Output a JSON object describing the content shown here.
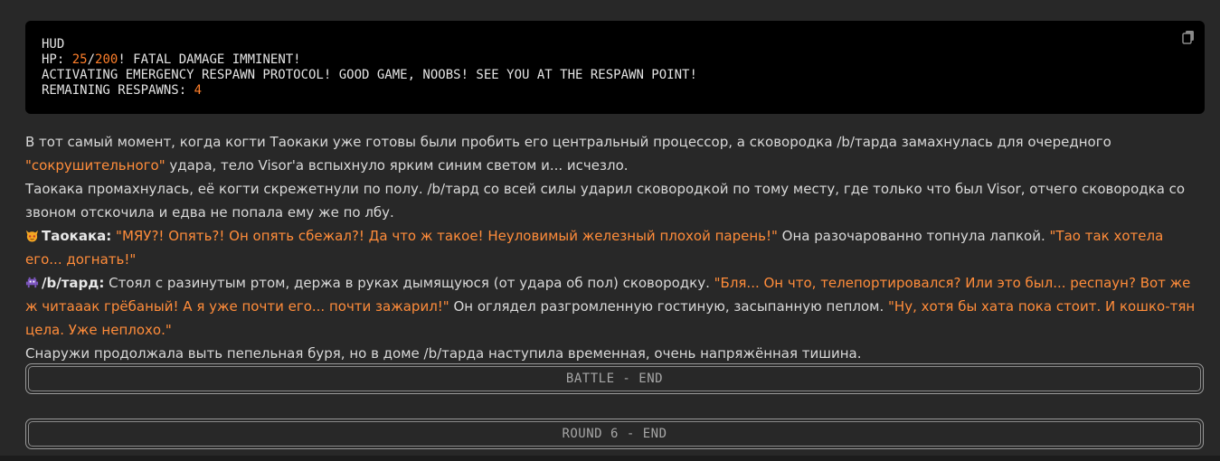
{
  "code": {
    "title": "HUD",
    "hp_label": "HP: ",
    "hp_current": "25",
    "hp_sep": "/",
    "hp_max": "200",
    "hp_suffix": "! FATAL DAMAGE IMMINENT!",
    "line_activate": "ACTIVATING EMERGENCY RESPAWN PROTOCOL! GOOD GAME, NOOBS! SEE YOU AT THE RESPAWN POINT!",
    "respawns_label": "REMAINING RESPAWNS: ",
    "respawns_value": "4",
    "copy_icon": "copy-icon"
  },
  "story": {
    "p1_a": "В тот самый момент, когда когти Таокаки уже готовы были пробить его центральный процессор, а сковородка /b/тарда замахнулась для очередного ",
    "p1_q": "\"сокрушительного\"",
    "p1_b": " удара, тело Visor'а вспыхнуло ярким синим светом и... исчезло.",
    "p2": "Таокака промахнулась, её когти скрежетнули по полу. /b/тард со всей силы ударил сковородкой по тому месту, где только что был Visor, отчего сковородка со звоном отскочила и едва не попала ему же по лбу.",
    "p3_emoji": "cat-face-icon",
    "p3_speaker": "Таокака:",
    "p3_q1": "\"МЯУ?! Опять?! Он опять сбежал?! Да что ж такое! Неуловимый железный плохой парень!\"",
    "p3_mid": " Она разочарованно топнула лапкой. ",
    "p3_q2": "\"Тао так хотела его... догнать!\"",
    "p4_emoji": "alien-monster-icon",
    "p4_speaker": "/b/тард:",
    "p4_a": " Стоял с разинутым ртом, держа в руках дымящуюся (от удара об пол) сковородку. ",
    "p4_q1": "\"Бля... Он что, телепортировался? Или это был... респаун? Вот же ж читааак грёбаный! А я уже почти его... почти зажарил!\"",
    "p4_mid": " Он оглядел разгромленную гостиную, засыпанную пеплом. ",
    "p4_q2": "\"Ну, хотя бы хата пока стоит. И кошко-тян цела. Уже неплохо.\"",
    "p5": "Снаружи продолжала выть пепельная буря, но в доме /b/тарда наступила временная, очень напряжённая тишина."
  },
  "boxes": {
    "battle_end": "BATTLE - END",
    "round_end": "ROUND 6 - END"
  },
  "colors": {
    "background": "#282828",
    "code_bg": "#000000",
    "accent_orange": "#ff7f2a"
  }
}
